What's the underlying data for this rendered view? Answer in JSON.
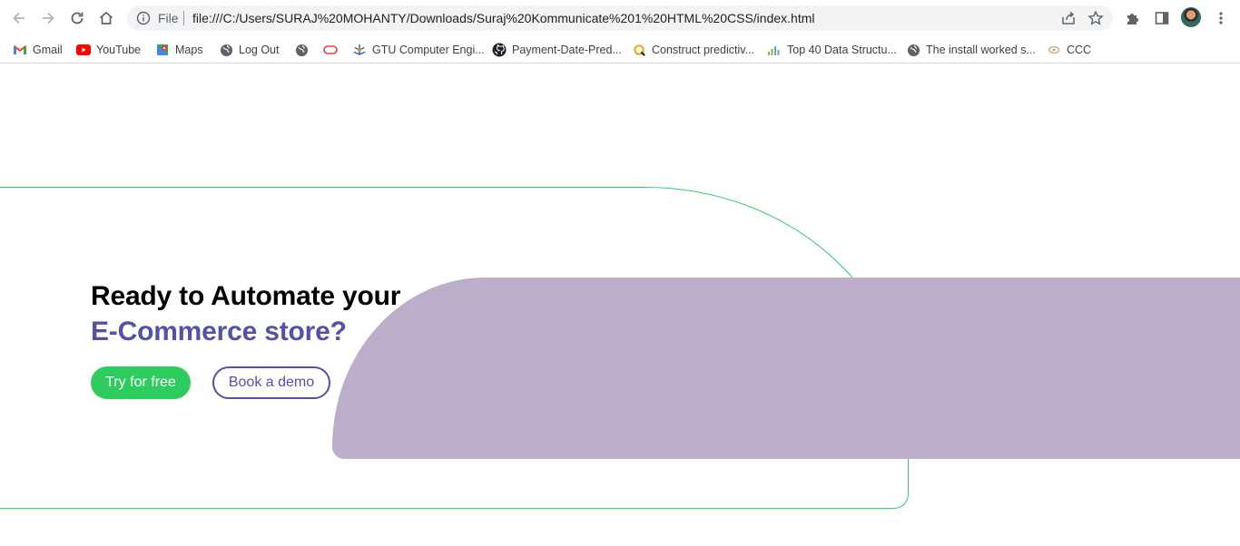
{
  "browser": {
    "scheme_label": "File",
    "url": "file:///C:/Users/SURAJ%20MOHANTY/Downloads/Suraj%20Kommunicate%201%20HTML%20CSS/index.html",
    "bookmarks": [
      {
        "label": "Gmail",
        "icon": "gmail-icon"
      },
      {
        "label": "YouTube",
        "icon": "youtube-icon"
      },
      {
        "label": "Maps",
        "icon": "maps-icon"
      },
      {
        "label": "Log Out",
        "icon": "globe-icon"
      },
      {
        "label": "",
        "icon": "globe-icon"
      },
      {
        "label": "",
        "icon": "oracle-icon"
      },
      {
        "label": "GTU Computer Engi...",
        "icon": "gtu-icon"
      },
      {
        "label": "Payment-Date-Pred...",
        "icon": "github-icon"
      },
      {
        "label": "Construct predictiv...",
        "icon": "q-icon"
      },
      {
        "label": "Top 40 Data Structu...",
        "icon": "chart-icon"
      },
      {
        "label": "The install worked s...",
        "icon": "globe-icon"
      },
      {
        "label": "CCC",
        "icon": "ccc-icon"
      }
    ]
  },
  "hero": {
    "headline_line1": "Ready to Automate your",
    "headline_line2": "E-Commerce store?",
    "primary_button": "Try for free",
    "secondary_button": "Book a demo"
  },
  "colors": {
    "accent": "#5451a8",
    "green": "#2ecc5e",
    "purple_shape": "#bcaecb",
    "outline": "#2ecc71"
  }
}
